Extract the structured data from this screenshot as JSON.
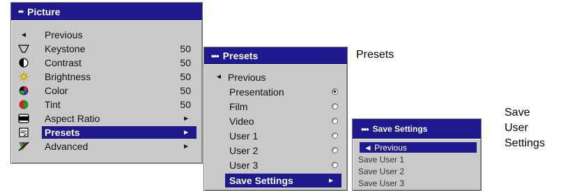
{
  "picture_menu": {
    "title": "Picture",
    "dots": "••",
    "items": [
      {
        "icon": "arrow-left-icon",
        "label": "Previous",
        "value": "",
        "arrow": ""
      },
      {
        "icon": "keystone-icon",
        "label": "Keystone",
        "value": "50",
        "arrow": ""
      },
      {
        "icon": "contrast-icon",
        "label": "Contrast",
        "value": "50",
        "arrow": ""
      },
      {
        "icon": "brightness-icon",
        "label": "Brightness",
        "value": "50",
        "arrow": ""
      },
      {
        "icon": "color-icon",
        "label": "Color",
        "value": "50",
        "arrow": ""
      },
      {
        "icon": "tint-icon",
        "label": "Tint",
        "value": "50",
        "arrow": ""
      },
      {
        "icon": "aspect-ratio-icon",
        "label": "Aspect Ratio",
        "value": "",
        "arrow": "►"
      },
      {
        "icon": "presets-icon",
        "label": "Presets",
        "value": "",
        "arrow": "►"
      },
      {
        "icon": "advanced-icon",
        "label": "Advanced",
        "value": "",
        "arrow": "►"
      }
    ]
  },
  "presets_menu": {
    "title": "Presets",
    "dots": "•••",
    "previous_arrow": "◄",
    "items": [
      {
        "label": "Previous"
      },
      {
        "label": "Presentation",
        "radio": "on"
      },
      {
        "label": "Film",
        "radio": "off"
      },
      {
        "label": "Video",
        "radio": "off"
      },
      {
        "label": "User 1",
        "radio": "off"
      },
      {
        "label": "User 2",
        "radio": "off"
      },
      {
        "label": "User 3",
        "radio": "off"
      },
      {
        "label": "Save Settings",
        "arrow": "►"
      }
    ]
  },
  "save_menu": {
    "title": "Save Settings",
    "dots": "•••",
    "items": [
      {
        "label": "◄ Previous"
      },
      {
        "label": "Save User 1"
      },
      {
        "label": "Save User 2"
      },
      {
        "label": "Save User 3"
      }
    ]
  },
  "labels": {
    "presets": "Presets",
    "save_line1": "Save",
    "save_line2": "User",
    "save_line3": "Settings"
  },
  "colors": {
    "title_bg": "#1e1a8e",
    "menu_bg": "#c9c9c9"
  }
}
